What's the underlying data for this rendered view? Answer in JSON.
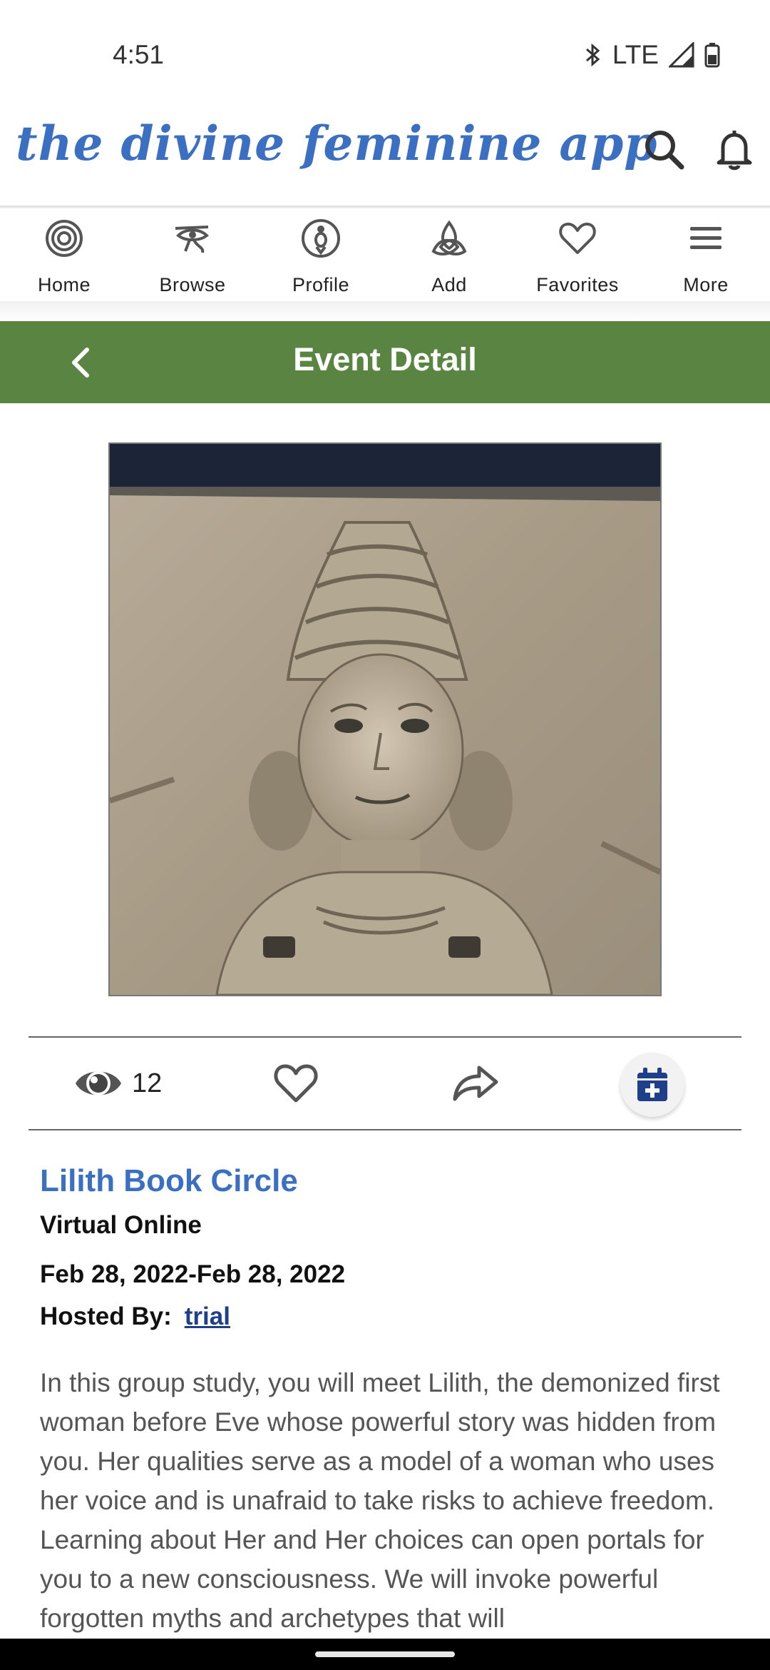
{
  "status": {
    "time": "4:51",
    "network": "LTE"
  },
  "header": {
    "logo_text": "the divine feminine app"
  },
  "nav": {
    "items": [
      {
        "label": "Home",
        "icon": "spiral-icon"
      },
      {
        "label": "Browse",
        "icon": "eye-of-horus-icon"
      },
      {
        "label": "Profile",
        "icon": "goddess-icon"
      },
      {
        "label": "Add",
        "icon": "triquetra-icon"
      },
      {
        "label": "Favorites",
        "icon": "heart-icon"
      },
      {
        "label": "More",
        "icon": "hamburger-icon"
      }
    ]
  },
  "titlebar": {
    "title": "Event Detail"
  },
  "actions": {
    "views": "12"
  },
  "event": {
    "title": "Lilith Book Circle",
    "location": "Virtual Online",
    "dates": "Feb 28, 2022-Feb 28, 2022",
    "hosted_label": "Hosted By:",
    "host": "trial",
    "description": "In this group study, you will meet Lilith, the demonized first woman before Eve whose powerful story was hidden from you. Her qualities serve as a model of a woman who uses her voice and is unafraid to take risks to achieve freedom. Learning about Her and Her choices can open portals for you to a new consciousness. We will invoke powerful forgotten myths and archetypes that will"
  },
  "colors": {
    "brand_blue": "#3a6fc2",
    "title_bar_green": "#5a8442",
    "link_navy": "#1f3f8a"
  }
}
